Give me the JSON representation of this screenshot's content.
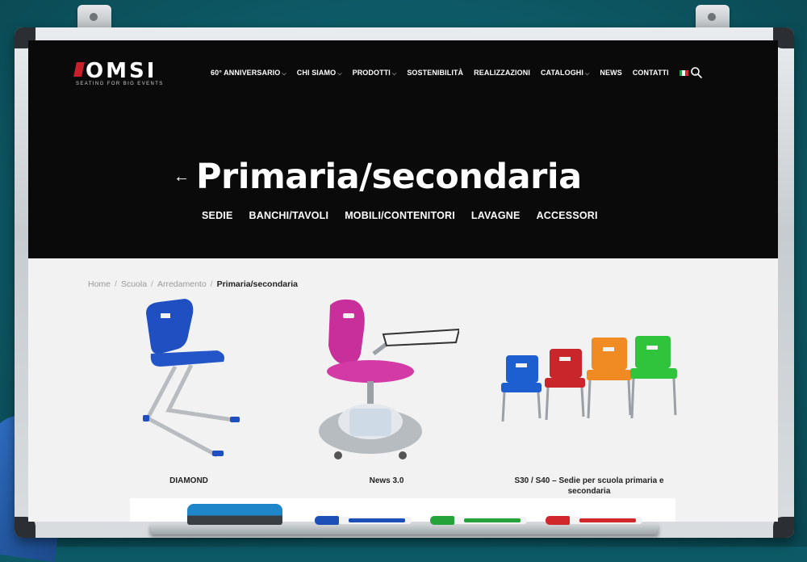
{
  "brand": {
    "logo_text": "OMSI",
    "tagline": "SEATING FOR BIG EVENTS"
  },
  "nav": {
    "items": [
      {
        "label": "60° ANNIVERSARIO",
        "has_dropdown": true
      },
      {
        "label": "CHI SIAMO",
        "has_dropdown": true
      },
      {
        "label": "PRODOTTI",
        "has_dropdown": true
      },
      {
        "label": "SOSTENIBILITÀ",
        "has_dropdown": false
      },
      {
        "label": "REALIZZAZIONI",
        "has_dropdown": false
      },
      {
        "label": "CATALOGHI",
        "has_dropdown": true
      },
      {
        "label": "NEWS",
        "has_dropdown": false
      },
      {
        "label": "CONTATTI",
        "has_dropdown": false
      }
    ],
    "language_icon": "italy-flag-icon",
    "search_icon": "search-icon"
  },
  "hero": {
    "back_icon": "arrow-left-icon",
    "title": "Primaria/secondaria",
    "subnav": [
      "SEDIE",
      "BANCHI/TAVOLI",
      "MOBILI/CONTENITORI",
      "LAVAGNE",
      "ACCESSORI"
    ]
  },
  "breadcrumb": {
    "items": [
      "Home",
      "Scuola",
      "Arredamento"
    ],
    "separator": "/",
    "current": "Primaria/secondaria"
  },
  "products": [
    {
      "name": "DIAMOND",
      "image": "blue-chair-image"
    },
    {
      "name": "News 3.0",
      "image": "pink-mobile-chair-image"
    },
    {
      "name": "S30 / S40 – Sedie per scuola primaria e secondaria",
      "image": "colored-school-chairs-image"
    }
  ],
  "colors": {
    "header_bg": "#0a0a0b",
    "content_bg": "#f2f2f2",
    "brand_red": "#c8202b",
    "background_teal": "#0d5a66"
  }
}
